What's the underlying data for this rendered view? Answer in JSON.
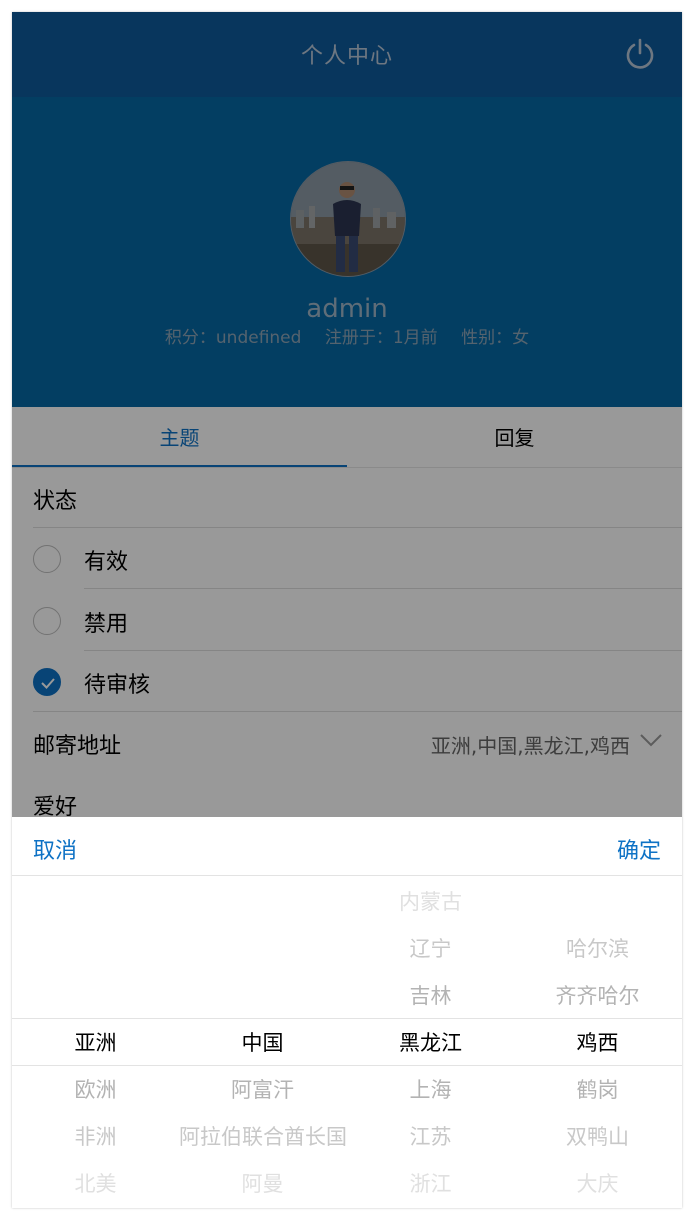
{
  "header": {
    "title": "个人中心",
    "power_icon": "power-icon"
  },
  "profile": {
    "username": "admin",
    "points": "积分：undefined",
    "registered": "注册于：1月前",
    "gender": "性别：女"
  },
  "tabs": [
    {
      "label": "主题"
    },
    {
      "label": "回复"
    }
  ],
  "form": {
    "status_label": "状态",
    "options": [
      {
        "label": "有效",
        "checked": false
      },
      {
        "label": "禁用",
        "checked": false
      },
      {
        "label": "待审核",
        "checked": true
      }
    ],
    "address_label": "邮寄地址",
    "address_value": "亚洲,中国,黑龙江,鸡西",
    "hobby_label": "爱好"
  },
  "picker": {
    "cancel_label": "取消",
    "ok_label": "确定",
    "columns": [
      {
        "items": [
          "",
          "",
          "",
          "亚洲",
          "欧洲",
          "非洲",
          "北美"
        ]
      },
      {
        "items": [
          "",
          "",
          "",
          "中国",
          "阿富汗",
          "阿拉伯联合酋长国",
          "阿曼"
        ]
      },
      {
        "items": [
          "内蒙古",
          "辽宁",
          "吉林",
          "黑龙江",
          "上海",
          "江苏",
          "浙江"
        ]
      },
      {
        "items": [
          "",
          "哈尔滨",
          "齐齐哈尔",
          "鸡西",
          "鹤岗",
          "双鸭山",
          "大庆"
        ]
      }
    ]
  },
  "colors": {
    "header": "#0e5a9c",
    "banner": "#0568a3",
    "accent": "#0e72c5"
  }
}
